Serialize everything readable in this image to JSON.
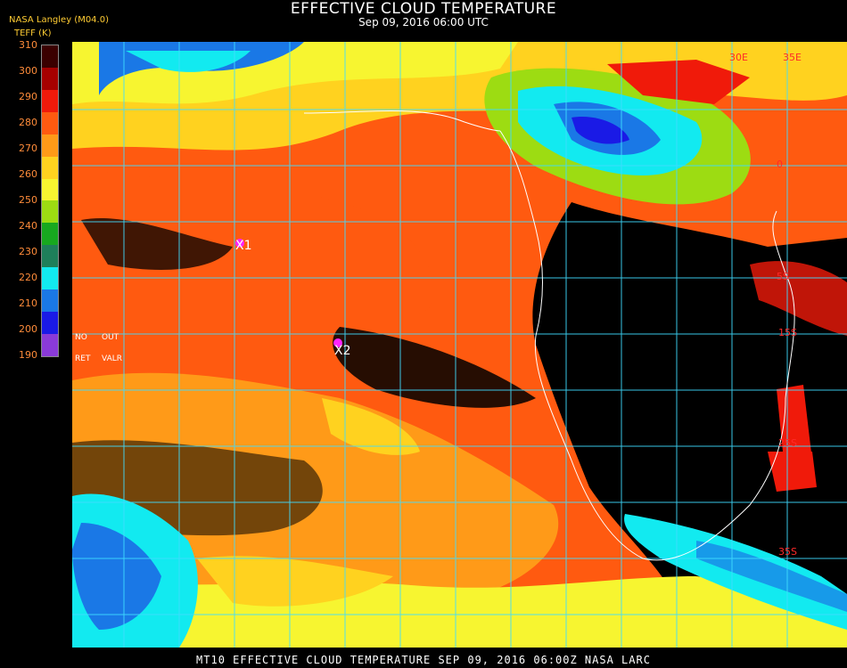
{
  "header": {
    "title": "EFFECTIVE CLOUD TEMPERATURE",
    "subtitle": "Sep 09, 2016 06:00 UTC",
    "credit": "NASA Langley (M04.0)",
    "units": "TEFF (K)"
  },
  "colorbar": {
    "ticks": [
      "310",
      "300",
      "290",
      "280",
      "270",
      "260",
      "250",
      "240",
      "230",
      "220",
      "210",
      "200",
      "190"
    ],
    "colors": [
      "#3a0000",
      "#a60000",
      "#f01a0a",
      "#ff5a10",
      "#ff9a18",
      "#ffd21f",
      "#f7f530",
      "#9ddc12",
      "#17a81f",
      "#1e7f5a",
      "#12eaf0",
      "#1a78e6",
      "#1a1ae6",
      "#8a3ad8"
    ]
  },
  "map": {
    "legend_labels": {
      "no": "NO",
      "out": "OUT",
      "ret": "RET",
      "valr": "VALR"
    },
    "markers": [
      {
        "label": "X1",
        "color": "#ff22ff"
      },
      {
        "label": "X2",
        "color": "#ff22ff"
      }
    ],
    "lat_labels": [
      "0",
      "5S",
      "15S",
      "25S",
      "35S"
    ],
    "lon_labels": [
      "30E",
      "35E"
    ],
    "grid_color": "#3fdcff",
    "coast_color": "#ffffff"
  },
  "footer": {
    "text": "MT10  EFFECTIVE CLOUD TEMPERATURE   SEP 09, 2016 06:00Z   NASA LARC"
  }
}
